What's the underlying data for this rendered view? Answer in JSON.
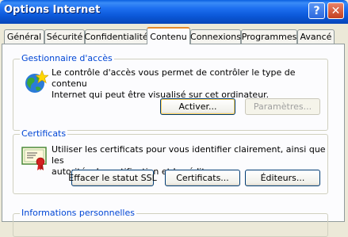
{
  "window": {
    "title": "Options Internet",
    "help_symbol": "?",
    "close_symbol": "✕"
  },
  "tabs": [
    {
      "label": "Général"
    },
    {
      "label": "Sécurité"
    },
    {
      "label": "Confidentialité"
    },
    {
      "label": "Contenu",
      "active": true
    },
    {
      "label": "Connexions"
    },
    {
      "label": "Programmes"
    },
    {
      "label": "Avancé"
    }
  ],
  "content_advisor": {
    "title": "Gestionnaire d'accès",
    "description_line1": "Le contrôle d'accès vous permet de contrôler le type de contenu",
    "description_line2": "Internet qui peut être visualisé sur cet ordinateur.",
    "icon": "globe-star-icon",
    "buttons": {
      "enable": "Activer...",
      "settings": "Paramètres..."
    }
  },
  "certificates": {
    "title": "Certificats",
    "description_line1": "Utiliser les certificats pour vous identifier clairement, ainsi que les",
    "description_line2": "autorités de certification et les éditeurs.",
    "icon": "certificate-icon",
    "buttons": {
      "clear_ssl": "Effacer le statut SSL",
      "certificates": "Certificats...",
      "publishers": "Éditeurs..."
    }
  },
  "personal_info": {
    "title": "Informations personnelles"
  }
}
